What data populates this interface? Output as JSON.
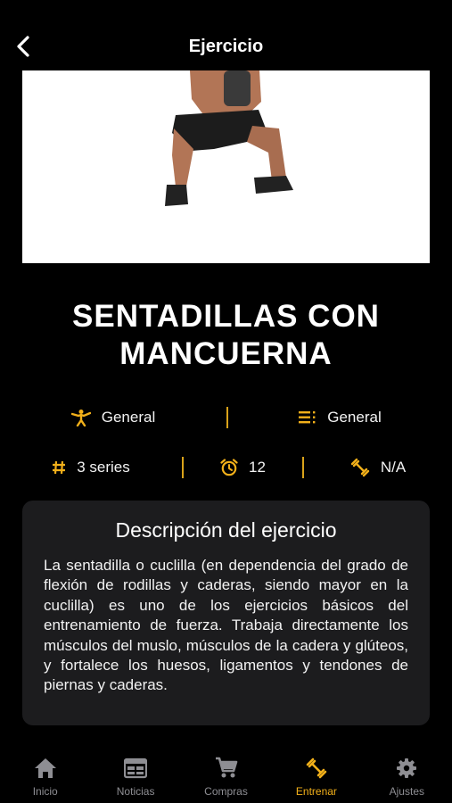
{
  "header": {
    "title": "Ejercicio"
  },
  "exercise": {
    "name": "SENTADILLAS CON MANCUERNA",
    "category": "General",
    "type": "General",
    "series": "3 series",
    "reps": "12",
    "weight": "N/A"
  },
  "description": {
    "heading": "Descripción del ejercicio",
    "text": "La sentadilla o cuclilla (en dependencia del grado de flexión de rodillas y caderas, siendo mayor en la cuclilla) es uno de los ejercicios básicos del entrenamiento de fuerza. Trabaja directamente los músculos del muslo, músculos de la cadera y glúteos, y fortalece los huesos, ligamentos y tendones de piernas y caderas."
  },
  "tabs": [
    {
      "label": "Inicio",
      "icon": "home-icon"
    },
    {
      "label": "Noticias",
      "icon": "news-icon"
    },
    {
      "label": "Compras",
      "icon": "cart-icon"
    },
    {
      "label": "Entrenar",
      "icon": "dumbbell-icon",
      "active": true
    },
    {
      "label": "Ajustes",
      "icon": "gear-icon"
    }
  ],
  "colors": {
    "accent": "#f2b01a",
    "card": "#1c1c1e",
    "inactive": "#8e8e93"
  }
}
